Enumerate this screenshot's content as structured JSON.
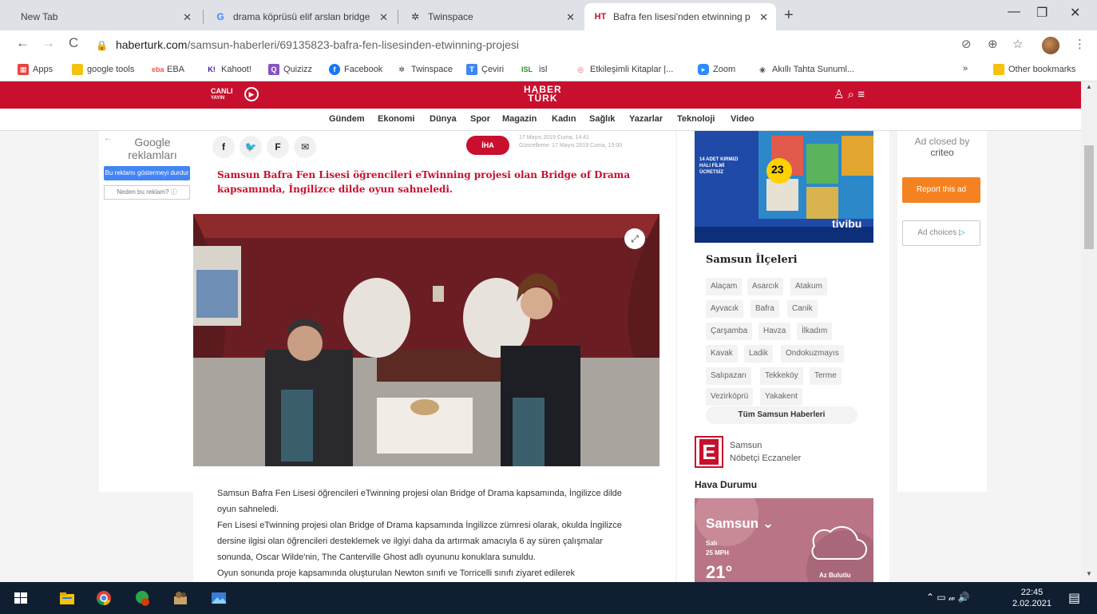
{
  "browser": {
    "tabs": [
      {
        "title": "New Tab",
        "active": false
      },
      {
        "title": "drama köprüsü elif arslan bridge",
        "active": false
      },
      {
        "title": "Twinspace",
        "active": false
      },
      {
        "title": "Bafra fen lisesi'nden etwinning p",
        "active": true
      }
    ],
    "url_host": "haberturk.com",
    "url_path": "/samsun-haberleri/69135823-bafra-fen-lisesinden-etwinning-projesi",
    "bookmarks": [
      "Apps",
      "google tools",
      "EBA",
      "Kahoot!",
      "Quizizz",
      "Facebook",
      "Twinspace",
      "Çeviri",
      "isl",
      "Etkileşimli Kitaplar |...",
      "Zoom",
      "Akıllı Tahta Sunuml..."
    ],
    "other_bookmarks": "Other bookmarks",
    "more_bookmarks": "»"
  },
  "site": {
    "canli": "CANLI",
    "canli_sub": "YAYIN",
    "logo_line1": "HABER",
    "logo_line2": "TÜRK",
    "menu": [
      "Gündem",
      "Ekonomi",
      "Dünya",
      "Spor",
      "Magazin",
      "Kadın",
      "Sağlık",
      "Yazarlar",
      "Teknoloji",
      "Video"
    ]
  },
  "left_ad": {
    "label": "Google reklamları",
    "stop_button": "Bu reklamı göstermeyi durdur",
    "why": "Neden bu reklam? ⓘ"
  },
  "article": {
    "source": "İHA",
    "published": "17 Mayıs 2019 Cuma, 14:41",
    "updated": "Güncelleme: 17 Mayıs 2019 Cuma, 15:00",
    "lead": "Samsun Bafra Fen Lisesi öğrencileri eTwinning projesi olan Bridge of Drama kapsamında, İngilizce dilde oyun sahneledi.",
    "body": [
      "Samsun Bafra Fen Lisesi öğrencileri eTwinning projesi olan Bridge of Drama kapsamında, İngilizce dilde oyun sahneledi.",
      "Fen Lisesi eTwinning projesi olan Bridge of Drama kapsamında İngilizce zümresi olarak, okulda İngilizce dersine ilgisi olan öğrencileri desteklemek ve ilgiyi daha da artırmak amacıyla 6 ay süren çalışmalar sonunda, Oscar Wilde'nin, The Canterville Ghost adlı oyununu konuklara sunuldu.",
      "Oyun sonunda proje kapsamında oluşturulan Newton sınıfı ve Torricelli sınıfı ziyaret edilerek"
    ]
  },
  "sidebar": {
    "ad_small": "14 ADET KIRMIZI HALI FİLMİ ÜCRETSİZ",
    "ad_price": "23",
    "ad_brand": "tivibu",
    "ilceler_title": "Samsun İlçeleri",
    "ilceler": [
      "Alaçam",
      "Asarcık",
      "Atakum",
      "Ayvacık",
      "Bafra",
      "Canik",
      "Çarşamba",
      "Havza",
      "İlkadım",
      "Kavak",
      "Ladik",
      "Ondokuzmayıs",
      "Salıpazarı",
      "Tekkeköy",
      "Terme",
      "Vezirköprü",
      "Yakakent"
    ],
    "all_news": "Tüm Samsun Haberleri",
    "eczane_city": "Samsun",
    "eczane_label": "Nöbetçi Eczaneler",
    "hava_title": "Hava Durumu",
    "hava_city": "Samsun",
    "hava_day": "Salı",
    "hava_wind": "25 MPH",
    "hava_temp": "21°",
    "hava_desc": "Az Bulutlu"
  },
  "right_ad": {
    "closed": "Ad closed by",
    "criteo": "criteo",
    "report": "Report this ad",
    "choices": "Ad choices"
  },
  "taskbar": {
    "time": "22:45",
    "date": "2.02.2021"
  }
}
